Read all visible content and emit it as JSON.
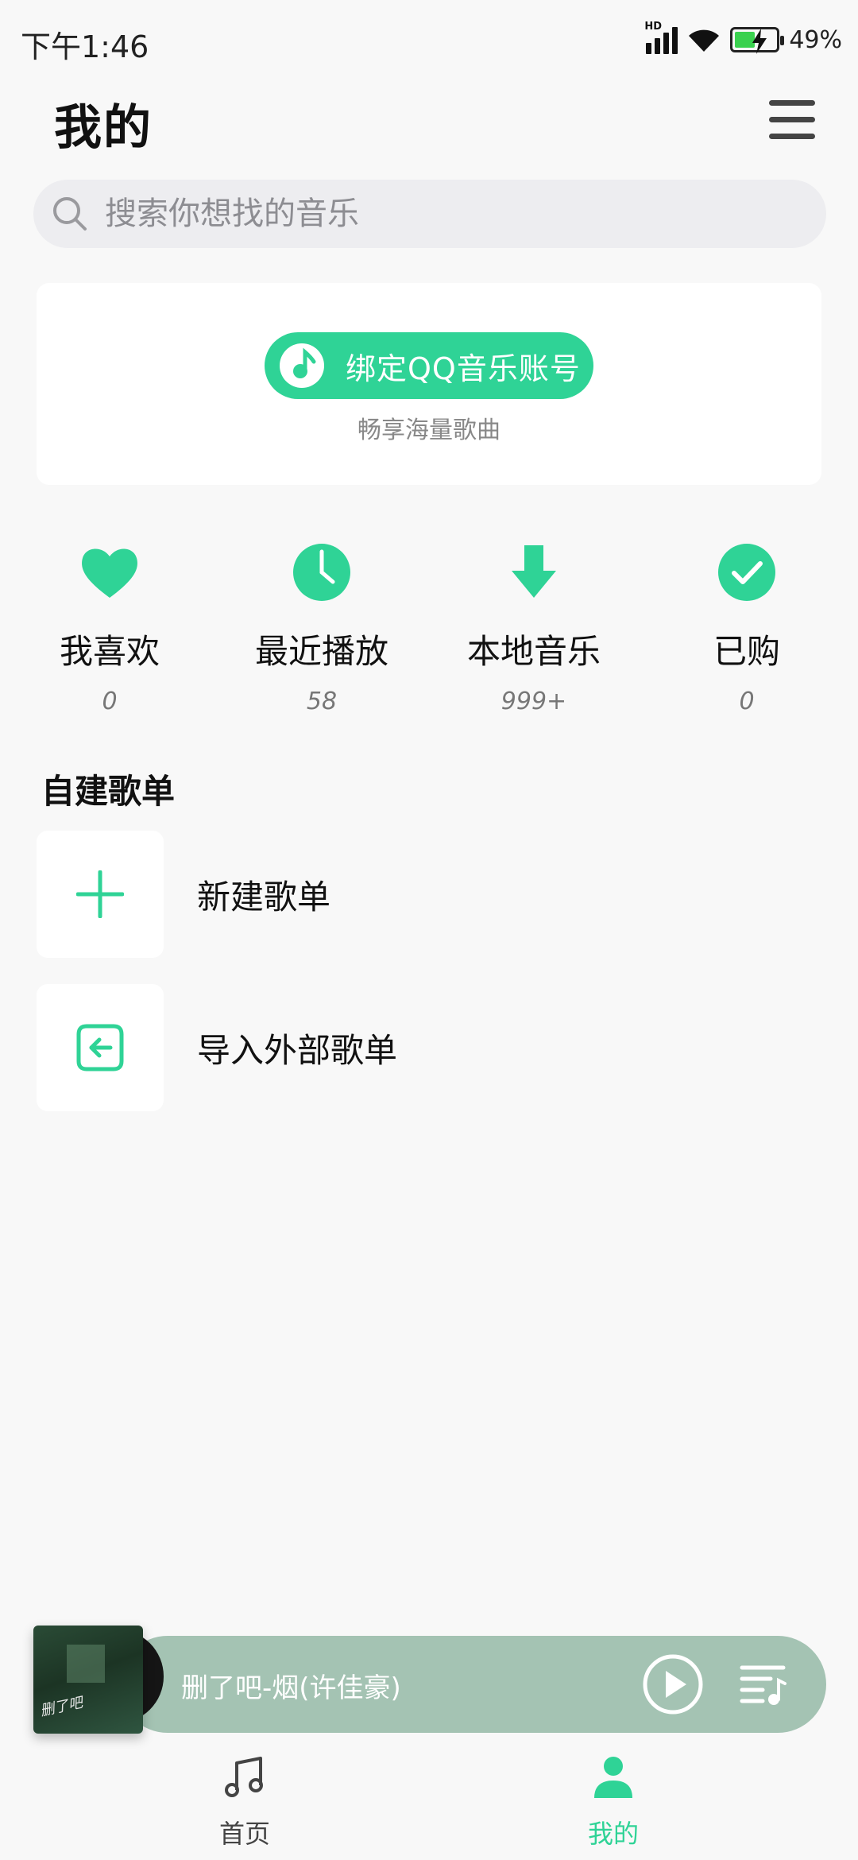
{
  "status_bar": {
    "time": "下午1:46",
    "network": "HD",
    "battery_percent": "49%",
    "battery_level": 0.49
  },
  "header": {
    "title": "我的",
    "menu_icon": "menu-icon"
  },
  "search": {
    "placeholder": "搜索你想找的音乐"
  },
  "bind_card": {
    "button_label": "绑定QQ音乐账号",
    "subtitle": "畅享海量歌曲"
  },
  "quick_entries": [
    {
      "label": "我喜欢",
      "count": "0",
      "icon": "heart-icon"
    },
    {
      "label": "最近播放",
      "count": "58",
      "icon": "clock-icon"
    },
    {
      "label": "本地音乐",
      "count": "999+",
      "icon": "download-icon"
    },
    {
      "label": "已购",
      "count": "0",
      "icon": "check-icon"
    }
  ],
  "playlists": {
    "section_title": "自建歌单",
    "items": [
      {
        "label": "新建歌单",
        "icon": "plus-icon"
      },
      {
        "label": "导入外部歌单",
        "icon": "import-icon"
      }
    ]
  },
  "player": {
    "song_title": "删了吧-烟(许佳豪)",
    "album_scribble": "删了吧"
  },
  "bottom_nav": [
    {
      "label": "首页",
      "icon": "music-note-icon",
      "active": false
    },
    {
      "label": "我的",
      "icon": "user-icon",
      "active": true
    }
  ],
  "colors": {
    "accent": "#2fd396",
    "player_bg": "#a4c3b3",
    "background": "#f8f8f8"
  }
}
